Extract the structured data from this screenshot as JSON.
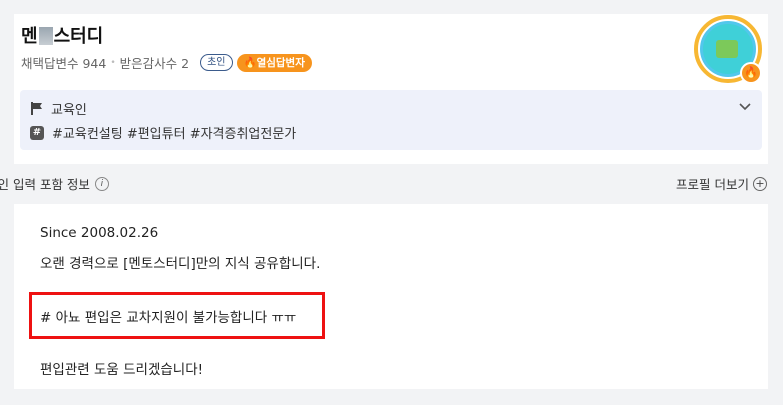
{
  "profile": {
    "name_prefix": "멘",
    "name_suffix": "스터디",
    "answers_label": "채택답변수 944",
    "thanks_label": "받은감사수 2",
    "level_badge": "초인",
    "hot_badge": "🔥열심답변자"
  },
  "info": {
    "category": "교육인",
    "tags": "#교육컨설팅 #편입튜터 #자격증취업전문가"
  },
  "section": {
    "left_text": "본인 입력 포함 정보",
    "info_icon": "i",
    "more_label": "프로필 더보기",
    "more_icon": "+"
  },
  "intro": {
    "line1": "Since 2008.02.26",
    "line2": "오랜 경력으로 [멘토스터디]만의 지식 공유합니다.",
    "line3": "# 아뇨 편입은 교차지원이 불가능합니다 ㅠㅠ",
    "line4": "편입관련 도움 드리겠습니다!"
  },
  "colors": {
    "accent_orange": "#f7941d",
    "highlight_red": "#ee1111",
    "info_bg": "#eef1fa"
  }
}
